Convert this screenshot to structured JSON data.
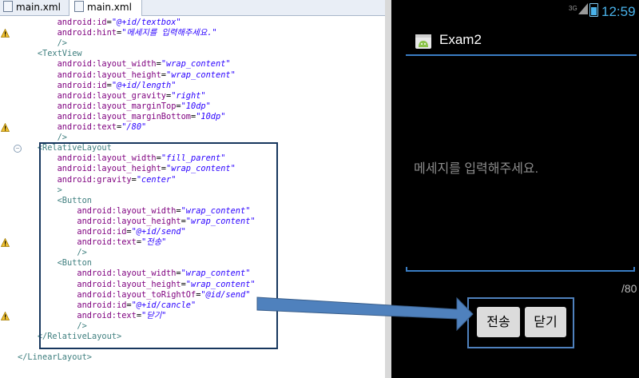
{
  "editor": {
    "tabs": [
      {
        "label": "main.xml"
      },
      {
        "label": "main.xml"
      }
    ],
    "code_lines": [
      {
        "indent": "        ",
        "tokens": [
          {
            "c": "an",
            "t": "android:id"
          },
          {
            "c": "pl",
            "t": "="
          },
          {
            "c": "av",
            "t": "\"@+id/textbox\""
          }
        ]
      },
      {
        "indent": "        ",
        "tokens": [
          {
            "c": "an",
            "t": "android:hint"
          },
          {
            "c": "pl",
            "t": "="
          },
          {
            "c": "av",
            "t": "\"메세지를 입력해주세요.\""
          }
        ]
      },
      {
        "indent": "        ",
        "tokens": [
          {
            "c": "tg",
            "t": "/>"
          }
        ]
      },
      {
        "indent": "    ",
        "tokens": [
          {
            "c": "tg",
            "t": "<TextView"
          }
        ]
      },
      {
        "indent": "        ",
        "tokens": [
          {
            "c": "an",
            "t": "android:layout_width"
          },
          {
            "c": "pl",
            "t": "="
          },
          {
            "c": "av",
            "t": "\"wrap_content\""
          }
        ]
      },
      {
        "indent": "        ",
        "tokens": [
          {
            "c": "an",
            "t": "android:layout_height"
          },
          {
            "c": "pl",
            "t": "="
          },
          {
            "c": "av",
            "t": "\"wrap_content\""
          }
        ]
      },
      {
        "indent": "        ",
        "tokens": [
          {
            "c": "an",
            "t": "android:id"
          },
          {
            "c": "pl",
            "t": "="
          },
          {
            "c": "av",
            "t": "\"@+id/length\""
          }
        ]
      },
      {
        "indent": "        ",
        "tokens": [
          {
            "c": "an",
            "t": "android:layout_gravity"
          },
          {
            "c": "pl",
            "t": "="
          },
          {
            "c": "av",
            "t": "\"right\""
          }
        ]
      },
      {
        "indent": "        ",
        "tokens": [
          {
            "c": "an",
            "t": "android:layout_marginTop"
          },
          {
            "c": "pl",
            "t": "="
          },
          {
            "c": "av",
            "t": "\"10dp\""
          }
        ]
      },
      {
        "indent": "        ",
        "tokens": [
          {
            "c": "an",
            "t": "android:layout_marginBottom"
          },
          {
            "c": "pl",
            "t": "="
          },
          {
            "c": "av",
            "t": "\"10dp\""
          }
        ]
      },
      {
        "indent": "        ",
        "tokens": [
          {
            "c": "an",
            "t": "android:text"
          },
          {
            "c": "pl",
            "t": "="
          },
          {
            "c": "av",
            "t": "\"/80\""
          }
        ]
      },
      {
        "indent": "        ",
        "tokens": [
          {
            "c": "tg",
            "t": "/>"
          }
        ]
      },
      {
        "indent": "    ",
        "tokens": [
          {
            "c": "tg",
            "t": "<RelativeLayout"
          }
        ]
      },
      {
        "indent": "        ",
        "tokens": [
          {
            "c": "an",
            "t": "android:layout_width"
          },
          {
            "c": "pl",
            "t": "="
          },
          {
            "c": "av",
            "t": "\"fill_parent\""
          }
        ]
      },
      {
        "indent": "        ",
        "tokens": [
          {
            "c": "an",
            "t": "android:layout_height"
          },
          {
            "c": "pl",
            "t": "="
          },
          {
            "c": "av",
            "t": "\"wrap_content\""
          }
        ]
      },
      {
        "indent": "        ",
        "tokens": [
          {
            "c": "an",
            "t": "android:gravity"
          },
          {
            "c": "pl",
            "t": "="
          },
          {
            "c": "av",
            "t": "\"center\""
          }
        ]
      },
      {
        "indent": "        ",
        "tokens": [
          {
            "c": "tg",
            "t": ">"
          }
        ]
      },
      {
        "indent": "        ",
        "tokens": [
          {
            "c": "tg",
            "t": "<Button"
          }
        ]
      },
      {
        "indent": "            ",
        "tokens": [
          {
            "c": "an",
            "t": "android:layout_width"
          },
          {
            "c": "pl",
            "t": "="
          },
          {
            "c": "av",
            "t": "\"wrap_content\""
          }
        ]
      },
      {
        "indent": "            ",
        "tokens": [
          {
            "c": "an",
            "t": "android:layout_height"
          },
          {
            "c": "pl",
            "t": "="
          },
          {
            "c": "av",
            "t": "\"wrap_content\""
          }
        ]
      },
      {
        "indent": "            ",
        "tokens": [
          {
            "c": "an",
            "t": "android:id"
          },
          {
            "c": "pl",
            "t": "="
          },
          {
            "c": "av",
            "t": "\"@+id/send\""
          }
        ]
      },
      {
        "indent": "            ",
        "tokens": [
          {
            "c": "an",
            "t": "android:text"
          },
          {
            "c": "pl",
            "t": "="
          },
          {
            "c": "av",
            "t": "\"전송\""
          }
        ]
      },
      {
        "indent": "            ",
        "tokens": [
          {
            "c": "tg",
            "t": "/>"
          }
        ]
      },
      {
        "indent": "        ",
        "tokens": [
          {
            "c": "tg",
            "t": "<Button"
          }
        ]
      },
      {
        "indent": "            ",
        "tokens": [
          {
            "c": "an",
            "t": "android:layout_width"
          },
          {
            "c": "pl",
            "t": "="
          },
          {
            "c": "av",
            "t": "\"wrap_content\""
          }
        ]
      },
      {
        "indent": "            ",
        "tokens": [
          {
            "c": "an",
            "t": "android:layout_height"
          },
          {
            "c": "pl",
            "t": "="
          },
          {
            "c": "av",
            "t": "\"wrap_content\""
          }
        ]
      },
      {
        "indent": "            ",
        "tokens": [
          {
            "c": "an",
            "t": "android:layout_toRightOf"
          },
          {
            "c": "pl",
            "t": "="
          },
          {
            "c": "av",
            "t": "\"@id/send\""
          }
        ]
      },
      {
        "indent": "            ",
        "tokens": [
          {
            "c": "an",
            "t": "android:id"
          },
          {
            "c": "pl",
            "t": "="
          },
          {
            "c": "av",
            "t": "\"@+id/cancle\""
          }
        ]
      },
      {
        "indent": "            ",
        "tokens": [
          {
            "c": "an",
            "t": "android:text"
          },
          {
            "c": "pl",
            "t": "="
          },
          {
            "c": "av",
            "t": "\"닫기\""
          }
        ]
      },
      {
        "indent": "            ",
        "tokens": [
          {
            "c": "tg",
            "t": "/>"
          }
        ]
      },
      {
        "indent": "    ",
        "tokens": [
          {
            "c": "tg",
            "t": "</RelativeLayout>"
          }
        ]
      },
      {
        "indent": "",
        "tokens": [
          {
            "c": "tg",
            "t": ""
          }
        ]
      },
      {
        "indent": "",
        "tokens": [
          {
            "c": "tg",
            "t": "</LinearLayout>"
          }
        ]
      }
    ]
  },
  "phone": {
    "status": {
      "network": "3G",
      "time": "12:59"
    },
    "app_title": "Exam2",
    "edittext_hint": "메세지를 입력해주세요.",
    "length_text": "/80",
    "buttons": {
      "send": "전송",
      "close": "닫기"
    }
  },
  "colors": {
    "accent_blue": "#3a7dc4",
    "highlight_box": "#17375e",
    "arrow_fill": "#4f81bd"
  }
}
